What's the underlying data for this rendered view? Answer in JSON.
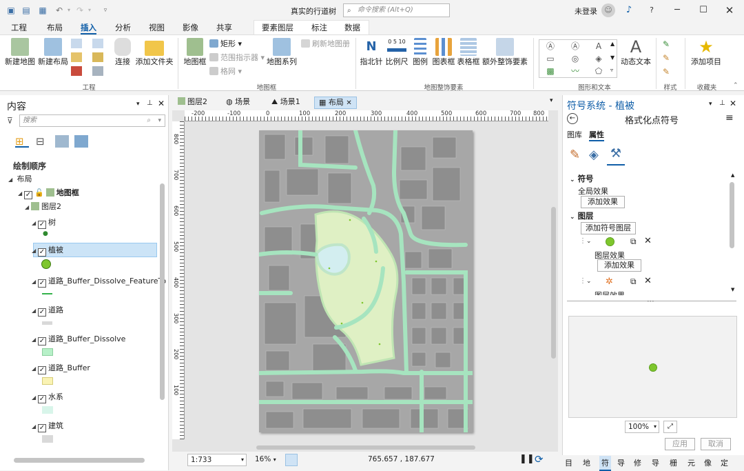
{
  "window": {
    "title": "真实的行道树",
    "search_placeholder": "命令搜索 (Alt+Q)",
    "user": "未登录"
  },
  "ribbon_tabs": [
    "工程",
    "布局",
    "插入",
    "分析",
    "视图",
    "影像",
    "共享",
    "要素图层",
    "标注",
    "数据"
  ],
  "active_tab": "插入",
  "ribbon": {
    "new_map": "新建地图",
    "new_layout": "新建布局",
    "connect": "连接",
    "add_folder": "添加文件夹",
    "group_project": "工程",
    "map_frame": "地图框",
    "rectangle": "矩形",
    "extent_indicator": "范围指示器",
    "grid": "格网",
    "refresh_map_series": "刷新地图册",
    "map_series": "地图系列",
    "group_map_frame": "地图框",
    "north_arrow": "指北针",
    "scale_bar": "比例尺",
    "legend": "图例",
    "chart_frame": "图表框",
    "table_frame": "表格框",
    "extra_elements": "额外整饰要素",
    "group_surround": "地图整饰要素",
    "dynamic_text": "动态文本",
    "group_graphics_text": "图形和文本",
    "group_styles": "样式",
    "add_item": "添加项目",
    "group_favorites": "收藏夹",
    "scale_nums": "0 5 10"
  },
  "contents": {
    "title": "内容",
    "search_placeholder": "搜索",
    "drawing_order": "绘制顺序",
    "layout": "布局",
    "map_frame": "地图框",
    "map": "图层2",
    "layers": [
      "树",
      "植被",
      "道路_Buffer_Dissolve_FeatureTo",
      "道路",
      "道路_Buffer_Dissolve",
      "道路_Buffer",
      "水系",
      "建筑"
    ],
    "swatch_colors": [
      "#2f8a2f",
      "#7ec62d",
      "#33b24a",
      "#d9d9d9",
      "#b7f0c8",
      "#faf3b4",
      "#d8f5ea",
      "#d9d9d9"
    ]
  },
  "doc_tabs": [
    "图层2",
    "场景",
    "场景1",
    "布局"
  ],
  "ruler_h": [
    "-200",
    "-100",
    "0",
    "100",
    "200",
    "300",
    "400",
    "500",
    "600",
    "700",
    "800"
  ],
  "ruler_v": [
    "800",
    "700",
    "600",
    "500",
    "400",
    "300",
    "200",
    "100"
  ],
  "status": {
    "scale": "1:733",
    "zoom": "16%",
    "coords": "765.657 , 187.677"
  },
  "symbology": {
    "title": "符号系统 - 植被",
    "subtitle": "格式化点符号",
    "tab_gallery": "图库",
    "tab_properties": "属性",
    "section_symbol": "符号",
    "global_effects": "全局效果",
    "add_effect": "添加效果",
    "section_layers": "图层",
    "add_symbol_layer": "添加符号图层",
    "layer_effects": "图层效果",
    "layer_effects2": "图层效果",
    "preview_zoom": "100%",
    "apply": "应用",
    "cancel": "取消"
  },
  "bottom_tabs": [
    "目",
    "地",
    "符",
    "导",
    "修",
    "导",
    "栅",
    "元",
    "像",
    "定"
  ]
}
